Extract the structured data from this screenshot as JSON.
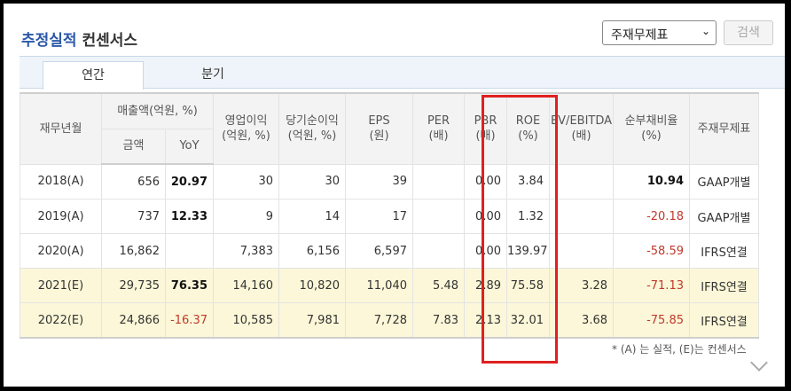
{
  "title": {
    "main": "추정실적",
    "sub": "컨센서스"
  },
  "select": {
    "value": "주재무제표"
  },
  "search_button": "검색",
  "tabs": [
    {
      "label": "연간"
    },
    {
      "label": "분기"
    }
  ],
  "table": {
    "headers": {
      "period": "재무년월",
      "sales_group": "매출액(억원, %)",
      "amount": "금액",
      "yoy": "YoY",
      "op": "영업이익\n(억원, %)",
      "net": "당기순이익\n(억원, %)",
      "eps": "EPS\n(원)",
      "per": "PER\n(배)",
      "pbr": "PBR\n(배)",
      "roe": "ROE\n(%)",
      "ev": "EV/EBITDA\n(배)",
      "debt": "순부채비율\n(%)",
      "std": "주재무제표"
    },
    "rows": [
      {
        "year": "2018(A)",
        "amount": "656",
        "yoy": "20.97",
        "op": "30",
        "net": "30",
        "eps": "39",
        "per": "",
        "pbr": "0.00",
        "roe": "3.84",
        "ev": "",
        "debt": "10.94",
        "std": "GAAP개별"
      },
      {
        "year": "2019(A)",
        "amount": "737",
        "yoy": "12.33",
        "op": "9",
        "net": "14",
        "eps": "17",
        "per": "",
        "pbr": "0.00",
        "roe": "1.32",
        "ev": "",
        "debt": "-20.18",
        "std": "GAAP개별"
      },
      {
        "year": "2020(A)",
        "amount": "16,862",
        "yoy": "",
        "op": "7,383",
        "net": "6,156",
        "eps": "6,597",
        "per": "",
        "pbr": "0.00",
        "roe": "139.97",
        "ev": "",
        "debt": "-58.59",
        "std": "IFRS연결"
      },
      {
        "year": "2021(E)",
        "amount": "29,735",
        "yoy": "76.35",
        "op": "14,160",
        "net": "10,820",
        "eps": "11,040",
        "per": "5.48",
        "pbr": "2.89",
        "roe": "75.58",
        "ev": "3.28",
        "debt": "-71.13",
        "std": "IFRS연결"
      },
      {
        "year": "2022(E)",
        "amount": "24,866",
        "yoy": "-16.37",
        "op": "10,585",
        "net": "7,981",
        "eps": "7,728",
        "per": "7.83",
        "pbr": "2.13",
        "roe": "32.01",
        "ev": "3.68",
        "debt": "-75.85",
        "std": "IFRS연결"
      }
    ]
  },
  "note": "* (A) 는 실적, (E)는 컨센서스",
  "colors": {
    "title_blue": "#2b58a8",
    "negative": "#c0392b",
    "estimate_row": "#fbf7d8",
    "highlight": "#e02020"
  }
}
